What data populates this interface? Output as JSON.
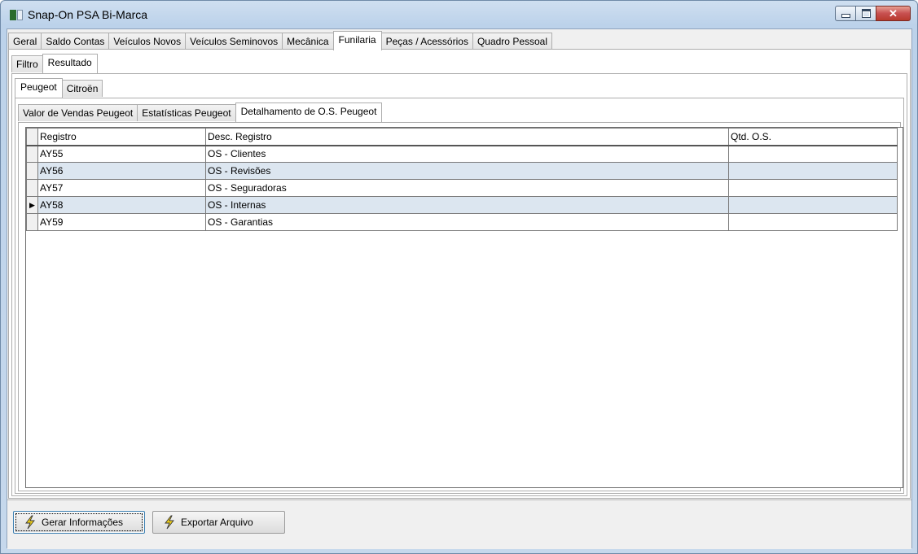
{
  "window": {
    "title": "Snap-On PSA Bi-Marca",
    "close_glyph": "✕"
  },
  "main_tabs": [
    "Geral",
    "Saldo Contas",
    "Veículos Novos",
    "Veículos Seminovos",
    "Mecânica",
    "Funilaria",
    "Peças / Acessórios",
    "Quadro Pessoal"
  ],
  "sub_tabs": [
    "Filtro",
    "Resultado"
  ],
  "brand_tabs": [
    "Peugeot",
    "Citroën"
  ],
  "report_tabs": [
    "Valor de Vendas Peugeot",
    "Estatísticas Peugeot",
    "Detalhamento de O.S. Peugeot"
  ],
  "grid": {
    "columns": [
      "Registro",
      "Desc. Registro",
      "Qtd. O.S."
    ],
    "rows": [
      {
        "registro": "AY55",
        "desc": "OS - Clientes",
        "qtd": ""
      },
      {
        "registro": "AY56",
        "desc": "OS - Revisões",
        "qtd": ""
      },
      {
        "registro": "AY57",
        "desc": "OS - Seguradoras",
        "qtd": ""
      },
      {
        "registro": "AY58",
        "desc": "OS - Internas",
        "qtd": ""
      },
      {
        "registro": "AY59",
        "desc": "OS - Garantias",
        "qtd": ""
      }
    ],
    "current_row_marker": "▶"
  },
  "buttons": {
    "gerar": "Gerar Informações",
    "exportar": "Exportar Arquivo"
  },
  "icons": {
    "button_icon": "lightning-bolt-icon",
    "bolt_color": "#f2d21a"
  }
}
